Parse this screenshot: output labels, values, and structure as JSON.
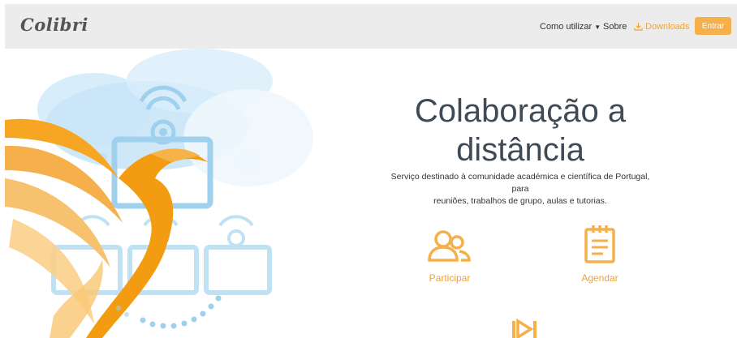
{
  "brand": {
    "logo_text": "Colibri"
  },
  "nav": {
    "items": [
      {
        "label": "Como utilizar",
        "has_dropdown": true
      },
      {
        "label": "Sobre"
      },
      {
        "label": "Downloads",
        "icon": "download-icon"
      }
    ],
    "login_label": "Entrar"
  },
  "hero": {
    "title_line1": "Colaboração a",
    "title_line2": "distância",
    "subtitle_line1": "Serviço destinado à comunidade académica e científica de Portugal, para",
    "subtitle_line2": "reuniões, trabalhos de grupo, aulas e tutorias."
  },
  "actions": [
    {
      "label": "Participar",
      "icon": "users-icon"
    },
    {
      "label": "Agendar",
      "icon": "clipboard-icon"
    },
    {
      "label": "",
      "icon": "skip-next-icon"
    }
  ],
  "colors": {
    "accent": "#f0a33a",
    "button": "#f5b04c",
    "navbar": "#ececec",
    "title": "#3f4a57",
    "illustration_blue": "#8cc8ea"
  }
}
